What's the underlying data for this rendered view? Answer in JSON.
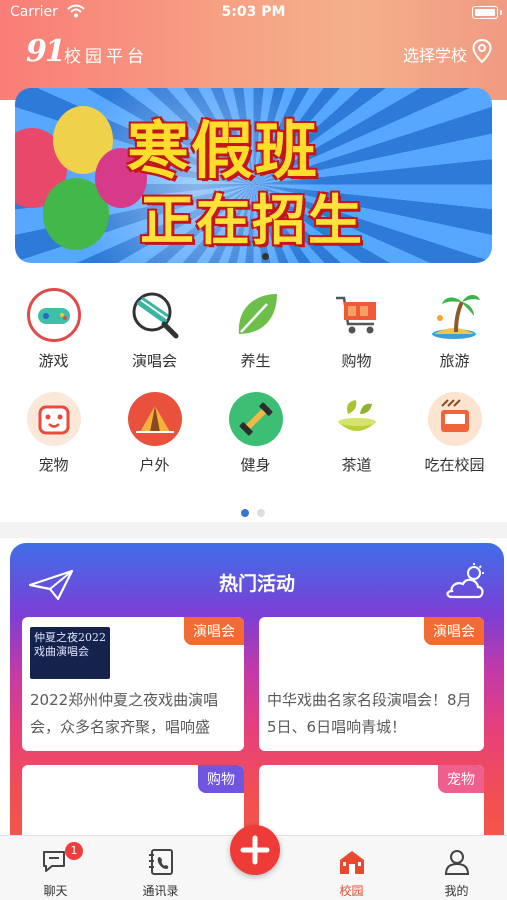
{
  "status_bar": {
    "carrier": "Carrier",
    "time": "5:03 PM"
  },
  "header": {
    "logo": "91",
    "logo_sub": "校园平台",
    "select_school": "选择学校"
  },
  "banner": {
    "line1": "寒假班",
    "line2": "正在招生"
  },
  "categories": [
    {
      "label": "游戏",
      "icon": "gamepad-icon"
    },
    {
      "label": "演唱会",
      "icon": "microphone-icon"
    },
    {
      "label": "养生",
      "icon": "leaf-icon"
    },
    {
      "label": "购物",
      "icon": "shopping-cart-icon"
    },
    {
      "label": "旅游",
      "icon": "palm-tree-icon"
    },
    {
      "label": "宠物",
      "icon": "pet-icon"
    },
    {
      "label": "户外",
      "icon": "tent-icon"
    },
    {
      "label": "健身",
      "icon": "dumbbell-icon"
    },
    {
      "label": "茶道",
      "icon": "tea-cup-icon"
    },
    {
      "label": "吃在校园",
      "icon": "food-icon"
    }
  ],
  "hot": {
    "title": "热门活动",
    "cards": [
      {
        "tag": "演唱会",
        "tag_color": "#f36b34",
        "thumb_text": "仲夏之夜2022 戏曲演唱会",
        "desc": "2022郑州仲夏之夜戏曲演唱会，众多名家齐聚，唱响盛"
      },
      {
        "tag": "演唱会",
        "tag_color": "#f36b34",
        "desc": "中华戏曲名家名段演唱会！8月5日、6日唱响青城！"
      },
      {
        "tag": "购物",
        "tag_color": "#6f55e0"
      },
      {
        "tag": "宠物",
        "tag_color": "#ef5f8d"
      }
    ]
  },
  "tabbar": {
    "items": [
      {
        "label": "聊天",
        "badge": "1"
      },
      {
        "label": "通讯录"
      },
      {
        "label": "校园",
        "active": true
      },
      {
        "label": "我的"
      }
    ],
    "active_color": "#e8492f"
  }
}
